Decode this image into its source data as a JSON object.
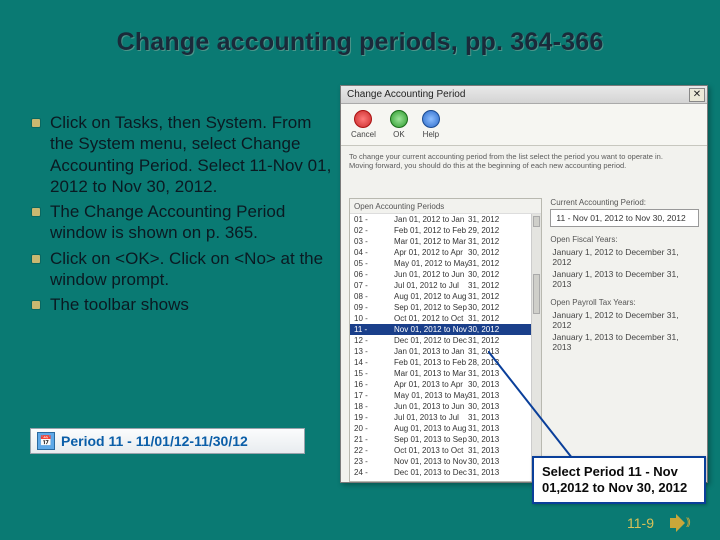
{
  "title": "Change accounting periods, pp. 364-366",
  "bullets": [
    "Click on Tasks, then System. From the System menu, select Change Accounting Period. Select 11-Nov 01, 2012 to Nov 30, 2012.",
    "The Change Accounting Period window is shown on p. 365.",
    "Click on <OK>. Click on <No> at the window prompt.",
    "The toolbar shows"
  ],
  "period_chip": {
    "icon_name": "calendar-icon",
    "text": "Period 11 - 11/01/12-11/30/12"
  },
  "window": {
    "title": "Change Accounting Period",
    "toolbar": {
      "cancel": "Cancel",
      "ok": "OK",
      "help": "Help"
    },
    "instructions_line1": "To change your current accounting period from the list select the period you want to operate in.",
    "instructions_line2": "Moving forward, you should do this at the beginning of each new accounting period.",
    "left_header": "Open Accounting Periods",
    "periods": [
      {
        "num": "01",
        "a": "Jan 01, 2012 to Jan",
        "b": "31, 2012"
      },
      {
        "num": "02",
        "a": "Feb 01, 2012 to Feb",
        "b": "29, 2012"
      },
      {
        "num": "03",
        "a": "Mar 01, 2012 to Mar",
        "b": "31, 2012"
      },
      {
        "num": "04",
        "a": "Apr 01, 2012 to Apr",
        "b": "30, 2012"
      },
      {
        "num": "05",
        "a": "May 01, 2012 to May",
        "b": "31, 2012"
      },
      {
        "num": "06",
        "a": "Jun 01, 2012 to Jun",
        "b": "30, 2012"
      },
      {
        "num": "07",
        "a": "Jul 01, 2012 to Jul",
        "b": "31, 2012"
      },
      {
        "num": "08",
        "a": "Aug 01, 2012 to Aug",
        "b": "31, 2012"
      },
      {
        "num": "09",
        "a": "Sep 01, 2012 to Sep",
        "b": "30, 2012"
      },
      {
        "num": "10",
        "a": "Oct 01, 2012 to Oct",
        "b": "31, 2012"
      },
      {
        "num": "11",
        "a": "Nov 01, 2012 to Nov",
        "b": "30, 2012"
      },
      {
        "num": "12",
        "a": "Dec 01, 2012 to Dec",
        "b": "31, 2012"
      },
      {
        "num": "13",
        "a": "Jan 01, 2013 to Jan",
        "b": "31, 2013"
      },
      {
        "num": "14",
        "a": "Feb 01, 2013 to Feb",
        "b": "28, 2013"
      },
      {
        "num": "15",
        "a": "Mar 01, 2013 to Mar",
        "b": "31, 2013"
      },
      {
        "num": "16",
        "a": "Apr 01, 2013 to Apr",
        "b": "30, 2013"
      },
      {
        "num": "17",
        "a": "May 01, 2013 to May",
        "b": "31, 2013"
      },
      {
        "num": "18",
        "a": "Jun 01, 2013 to Jun",
        "b": "30, 2013"
      },
      {
        "num": "19",
        "a": "Jul 01, 2013 to Jul",
        "b": "31, 2013"
      },
      {
        "num": "20",
        "a": "Aug 01, 2013 to Aug",
        "b": "31, 2013"
      },
      {
        "num": "21",
        "a": "Sep 01, 2013 to Sep",
        "b": "30, 2013"
      },
      {
        "num": "22",
        "a": "Oct 01, 2013 to Oct",
        "b": "31, 2013"
      },
      {
        "num": "23",
        "a": "Nov 01, 2013 to Nov",
        "b": "30, 2013"
      },
      {
        "num": "24",
        "a": "Dec 01, 2013 to Dec",
        "b": "31, 2013"
      }
    ],
    "selected_index": 10,
    "right": {
      "current_label": "Current Accounting Period:",
      "current_value": "11 - Nov 01, 2012 to Nov 30, 2012",
      "fiscal_label": "Open Fiscal Years:",
      "fiscal_1": "January 1, 2012 to December 31, 2012",
      "fiscal_2": "January 1, 2013 to December 31, 2013",
      "payroll_label": "Open Payroll Tax Years:",
      "payroll_1": "January 1, 2012 to December 31, 2012",
      "payroll_2": "January 1, 2013 to December 31, 2013"
    }
  },
  "callout": "Select Period 11 - Nov 01,2012 to Nov 30, 2012",
  "footer": {
    "page": "11-9"
  }
}
